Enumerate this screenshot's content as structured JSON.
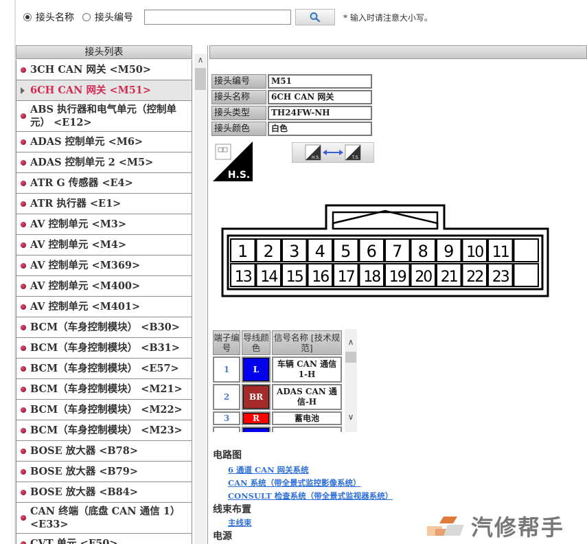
{
  "search": {
    "radio_name_label": "接头名称",
    "radio_code_label": "接头编号",
    "input_value": "",
    "hint": "* 输入时请注意大小写。"
  },
  "list": {
    "header": "接头列表",
    "items": [
      {
        "label": "3CH CAN 网关 <M50>"
      },
      {
        "label": "6CH CAN 网关 <M51>",
        "selected": true
      },
      {
        "label": "ABS 执行器和电气单元（控制单元） <E12>"
      },
      {
        "label": "ADAS 控制单元 <M6>"
      },
      {
        "label": "ADAS 控制单元 2 <M5>"
      },
      {
        "label": "ATR G 传感器 <E4>"
      },
      {
        "label": "ATR 执行器 <E1>"
      },
      {
        "label": "AV 控制单元 <M3>"
      },
      {
        "label": "AV 控制单元 <M4>"
      },
      {
        "label": "AV 控制单元 <M369>"
      },
      {
        "label": "AV 控制单元 <M400>"
      },
      {
        "label": "AV 控制单元 <M401>"
      },
      {
        "label": "BCM（车身控制模块） <B30>"
      },
      {
        "label": "BCM（车身控制模块） <B31>"
      },
      {
        "label": "BCM（车身控制模块） <E57>"
      },
      {
        "label": "BCM（车身控制模块） <M21>"
      },
      {
        "label": "BCM（车身控制模块） <M22>"
      },
      {
        "label": "BCM（车身控制模块） <M23>"
      },
      {
        "label": "BOSE 放大器 <B78>"
      },
      {
        "label": "BOSE 放大器 <B79>"
      },
      {
        "label": "BOSE 放大器 <B84>"
      },
      {
        "label": "CAN 终端（底盘 CAN 通信 1） <E33>"
      },
      {
        "label": "CVT 单元 <F50>"
      }
    ]
  },
  "connector_info": {
    "rows": [
      {
        "label": "接头编号",
        "value": "M51"
      },
      {
        "label": "接头名称",
        "value": "6CH CAN 网关"
      },
      {
        "label": "接头类型",
        "value": "TH24FW-NH"
      },
      {
        "label": "接头颜色",
        "value": "白色"
      }
    ],
    "hs_label": "H.S.",
    "swap_hs": "H.S.",
    "swap_ts": "T.S."
  },
  "pins": {
    "row1": [
      "1",
      "2",
      "3",
      "4",
      "5",
      "6",
      "7",
      "8",
      "9",
      "10",
      "11",
      ""
    ],
    "row2": [
      "13",
      "14",
      "15",
      "16",
      "17",
      "18",
      "19",
      "20",
      "21",
      "22",
      "23",
      ""
    ]
  },
  "terminals": {
    "headers": [
      "端子编号",
      "导线颜色",
      "信号名称 [技术规范]"
    ],
    "rows": [
      {
        "no": "1",
        "color_code": "L",
        "color_hex": "#0000ee",
        "signal": "车辆 CAN 通信 1-H"
      },
      {
        "no": "2",
        "color_code": "BR",
        "color_hex": "#a52a2a",
        "signal": "ADAS CAN 通信-H"
      },
      {
        "no": "3",
        "color_code": "R",
        "color_hex": "#ff0000",
        "signal": "蓄电池"
      },
      {
        "no": "",
        "color_code": "",
        "color_hex": "#0000ee",
        "signal": "车辆 CAN 通信"
      }
    ]
  },
  "sections": {
    "circuit_title": "电路图",
    "circuit_links": [
      "6 通道 CAN 网关系统",
      "CAN 系统（带全景式监控影像系统）",
      "CONSULT 检查系统（带全景式监视器系统）"
    ],
    "harness_title": "线束布置",
    "harness_links": [
      "主线束"
    ],
    "power_title": "电源"
  },
  "watermark": "汽修帮手"
}
